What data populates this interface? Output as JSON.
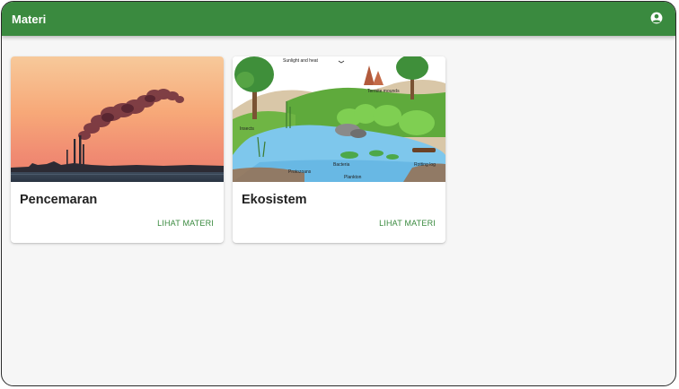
{
  "appbar": {
    "title": "Materi",
    "account_icon": "account-circle-icon",
    "color": "#3a8a3f"
  },
  "cards": [
    {
      "title": "Pencemaran",
      "action": "LIHAT MATERI",
      "image": "industrial-pollution-sunset-photo"
    },
    {
      "title": "Ekosistem",
      "action": "LIHAT MATERI",
      "image": "pond-ecosystem-diagram",
      "diagram_labels": {
        "sun": "Sunlight and heat",
        "termite": "Termite mounds",
        "insects": "Insects",
        "bacteria": "Bacteria",
        "protozoans": "Protozoans",
        "plankton": "Plankton",
        "log": "Rotting log"
      }
    }
  ]
}
